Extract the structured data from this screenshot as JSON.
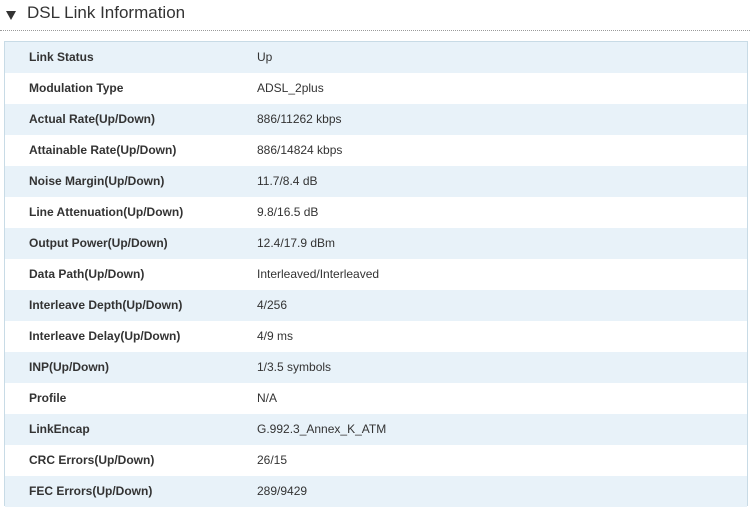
{
  "section": {
    "title": "DSL Link Information",
    "toggle_icon": "triangle-down-icon"
  },
  "colors": {
    "row_shade": "#e8f2f9",
    "panel_border": "#c8dbe6",
    "text": "#333333"
  },
  "rows": [
    {
      "label": "Link Status",
      "value": "Up"
    },
    {
      "label": "Modulation Type",
      "value": "ADSL_2plus"
    },
    {
      "label": "Actual Rate(Up/Down)",
      "value": "886/11262 kbps"
    },
    {
      "label": "Attainable Rate(Up/Down)",
      "value": "886/14824 kbps"
    },
    {
      "label": "Noise Margin(Up/Down)",
      "value": "11.7/8.4 dB"
    },
    {
      "label": "Line Attenuation(Up/Down)",
      "value": "9.8/16.5 dB"
    },
    {
      "label": "Output Power(Up/Down)",
      "value": "12.4/17.9 dBm"
    },
    {
      "label": "Data Path(Up/Down)",
      "value": "Interleaved/Interleaved"
    },
    {
      "label": "Interleave Depth(Up/Down)",
      "value": "4/256"
    },
    {
      "label": "Interleave Delay(Up/Down)",
      "value": "4/9 ms"
    },
    {
      "label": "INP(Up/Down)",
      "value": "1/3.5 symbols"
    },
    {
      "label": "Profile",
      "value": "N/A"
    },
    {
      "label": "LinkEncap",
      "value": "G.992.3_Annex_K_ATM"
    },
    {
      "label": "CRC Errors(Up/Down)",
      "value": "26/15"
    },
    {
      "label": "FEC Errors(Up/Down)",
      "value": "289/9429"
    }
  ]
}
